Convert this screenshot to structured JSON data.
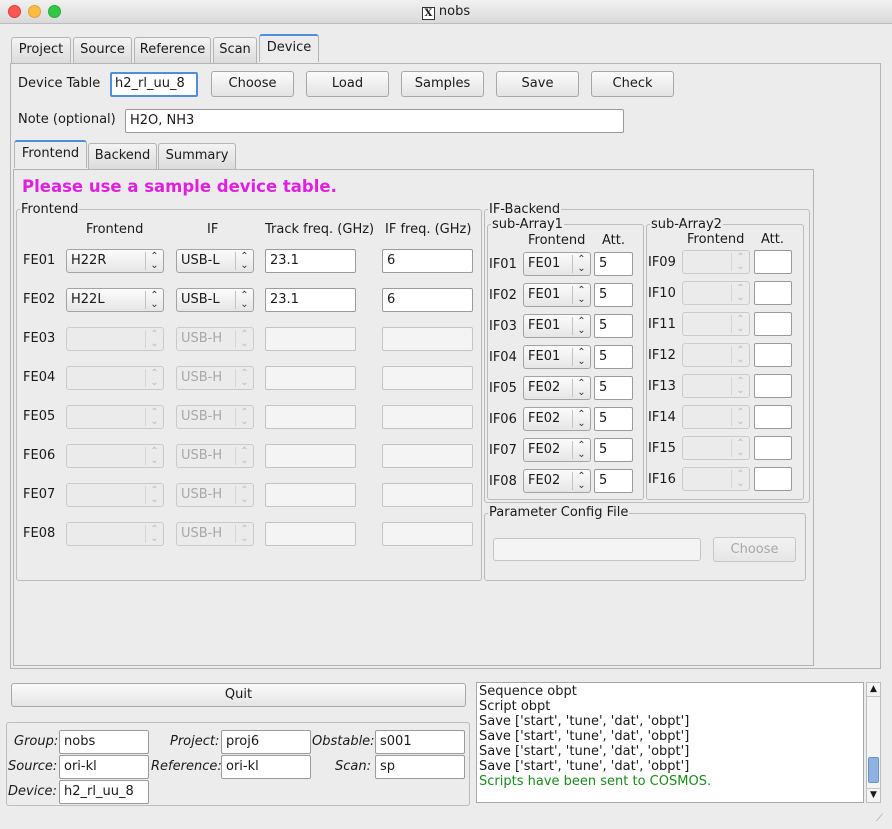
{
  "window": {
    "title": "nobs"
  },
  "main_tabs": [
    "Project",
    "Source",
    "Reference",
    "Scan",
    "Device"
  ],
  "device": {
    "table_label": "Device Table",
    "table_value": "h2_rl_uu_8",
    "buttons": {
      "choose": "Choose",
      "load": "Load",
      "samples": "Samples",
      "save": "Save",
      "check": "Check"
    },
    "note_label": "Note (optional)",
    "note_value": "H2O, NH3"
  },
  "sub_tabs": [
    "Frontend",
    "Backend",
    "Summary"
  ],
  "warning": "Please use a sample device table.",
  "frontend": {
    "group_title": "Frontend",
    "headers": {
      "frontend": "Frontend",
      "if": "IF",
      "track": "Track freq. (GHz)",
      "iffreq": "IF freq. (GHz)"
    },
    "rows": [
      {
        "label": "FE01",
        "frontend": "H22R",
        "if": "USB-L",
        "track": "23.1",
        "iffreq": "6"
      },
      {
        "label": "FE02",
        "frontend": "H22L",
        "if": "USB-L",
        "track": "23.1",
        "iffreq": "6"
      },
      {
        "label": "FE03",
        "frontend": "",
        "if": "USB-H",
        "track": "",
        "iffreq": ""
      },
      {
        "label": "FE04",
        "frontend": "",
        "if": "USB-H",
        "track": "",
        "iffreq": ""
      },
      {
        "label": "FE05",
        "frontend": "",
        "if": "USB-H",
        "track": "",
        "iffreq": ""
      },
      {
        "label": "FE06",
        "frontend": "",
        "if": "USB-H",
        "track": "",
        "iffreq": ""
      },
      {
        "label": "FE07",
        "frontend": "",
        "if": "USB-H",
        "track": "",
        "iffreq": ""
      },
      {
        "label": "FE08",
        "frontend": "",
        "if": "USB-H",
        "track": "",
        "iffreq": ""
      }
    ]
  },
  "if_backend": {
    "group_title": "IF-Backend",
    "sub1": {
      "title": "sub-Array1",
      "h_frontend": "Frontend",
      "h_att": "Att.",
      "rows": [
        {
          "label": "IF01",
          "frontend": "FE01",
          "att": "5"
        },
        {
          "label": "IF02",
          "frontend": "FE01",
          "att": "5"
        },
        {
          "label": "IF03",
          "frontend": "FE01",
          "att": "5"
        },
        {
          "label": "IF04",
          "frontend": "FE01",
          "att": "5"
        },
        {
          "label": "IF05",
          "frontend": "FE02",
          "att": "5"
        },
        {
          "label": "IF06",
          "frontend": "FE02",
          "att": "5"
        },
        {
          "label": "IF07",
          "frontend": "FE02",
          "att": "5"
        },
        {
          "label": "IF08",
          "frontend": "FE02",
          "att": "5"
        }
      ]
    },
    "sub2": {
      "title": "sub-Array2",
      "h_frontend": "Frontend",
      "h_att": "Att.",
      "rows": [
        {
          "label": "IF09",
          "frontend": "",
          "att": ""
        },
        {
          "label": "IF10",
          "frontend": "",
          "att": ""
        },
        {
          "label": "IF11",
          "frontend": "",
          "att": ""
        },
        {
          "label": "IF12",
          "frontend": "",
          "att": ""
        },
        {
          "label": "IF13",
          "frontend": "",
          "att": ""
        },
        {
          "label": "IF14",
          "frontend": "",
          "att": ""
        },
        {
          "label": "IF15",
          "frontend": "",
          "att": ""
        },
        {
          "label": "IF16",
          "frontend": "",
          "att": ""
        }
      ]
    }
  },
  "param_config": {
    "title": "Parameter Config File",
    "value": "",
    "choose": "Choose"
  },
  "quit_label": "Quit",
  "info": {
    "group_label": "Group:",
    "group": "nobs",
    "project_label": "Project:",
    "project": "proj6",
    "obstable_label": "Obstable:",
    "obstable": "s001",
    "source_label": "Source:",
    "source": "ori-kl",
    "reference_label": "Reference:",
    "reference": "ori-kl",
    "scan_label": "Scan:",
    "scan": "sp",
    "device_label": "Device:",
    "device": "h2_rl_uu_8"
  },
  "log": {
    "lines": [
      "Sequence obpt",
      "Script obpt",
      "Save ['start', 'tune', 'dat', 'obpt']",
      "Save ['start', 'tune', 'dat', 'obpt']",
      "Save ['start', 'tune', 'dat', 'obpt']",
      "Save ['start', 'tune', 'dat', 'obpt']"
    ],
    "success": "Scripts have been sent to COSMOS."
  },
  "colors": {
    "accent": "#4f8ed8",
    "warning": "#e020e0",
    "success": "#1a8a1a",
    "close": "#fc5753",
    "minimize": "#fdbc40",
    "maximize": "#33c748"
  }
}
